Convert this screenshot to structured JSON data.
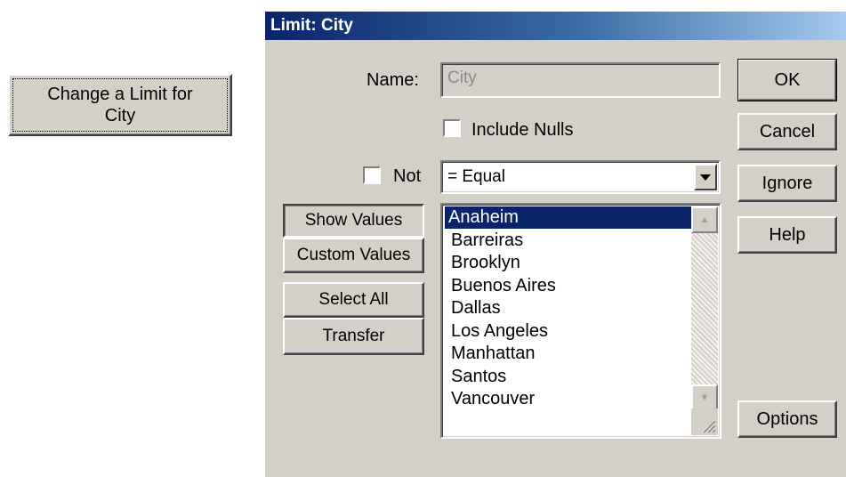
{
  "launcher": {
    "label_line1": "Change a Limit for",
    "label_line2": "City"
  },
  "dialog": {
    "title": "Limit: City",
    "name_label": "Name:",
    "name_value": "City",
    "include_nulls_label": "Include Nulls",
    "include_nulls_checked": false,
    "not_label": "Not",
    "not_checked": false,
    "operator_value": "= Equal",
    "buttons": {
      "ok": "OK",
      "cancel": "Cancel",
      "ignore": "Ignore",
      "help": "Help",
      "options": "Options"
    },
    "left_buttons": {
      "show_values": "Show Values",
      "custom_values": "Custom Values",
      "select_all": "Select All",
      "transfer": "Transfer"
    },
    "values": [
      {
        "label": "Anaheim",
        "selected": true
      },
      {
        "label": "Barreiras",
        "selected": false
      },
      {
        "label": "Brooklyn",
        "selected": false
      },
      {
        "label": "Buenos Aires",
        "selected": false
      },
      {
        "label": "Dallas",
        "selected": false
      },
      {
        "label": "Los Angeles",
        "selected": false
      },
      {
        "label": "Manhattan",
        "selected": false
      },
      {
        "label": "Santos",
        "selected": false
      },
      {
        "label": "Vancouver",
        "selected": false
      }
    ]
  },
  "colors": {
    "face": "#d4d0c8",
    "title_start": "#0a246a",
    "title_end": "#a6caf0",
    "selection": "#0a246a"
  },
  "icons": [
    "dropdown-arrow-icon",
    "scroll-up-icon",
    "scroll-down-icon",
    "resize-grip-icon"
  ]
}
